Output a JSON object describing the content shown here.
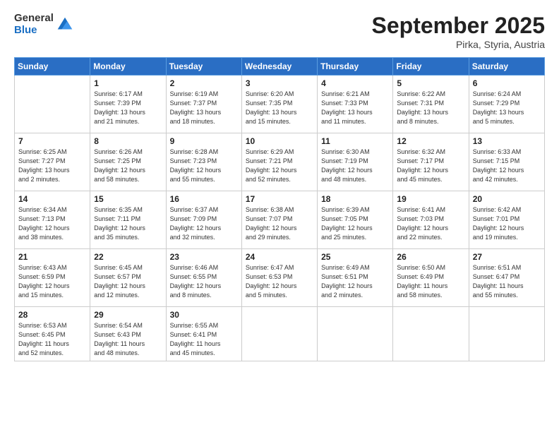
{
  "header": {
    "logo_general": "General",
    "logo_blue": "Blue",
    "month_title": "September 2025",
    "location": "Pirka, Styria, Austria"
  },
  "weekdays": [
    "Sunday",
    "Monday",
    "Tuesday",
    "Wednesday",
    "Thursday",
    "Friday",
    "Saturday"
  ],
  "weeks": [
    [
      {
        "day": "",
        "info": ""
      },
      {
        "day": "1",
        "info": "Sunrise: 6:17 AM\nSunset: 7:39 PM\nDaylight: 13 hours\nand 21 minutes."
      },
      {
        "day": "2",
        "info": "Sunrise: 6:19 AM\nSunset: 7:37 PM\nDaylight: 13 hours\nand 18 minutes."
      },
      {
        "day": "3",
        "info": "Sunrise: 6:20 AM\nSunset: 7:35 PM\nDaylight: 13 hours\nand 15 minutes."
      },
      {
        "day": "4",
        "info": "Sunrise: 6:21 AM\nSunset: 7:33 PM\nDaylight: 13 hours\nand 11 minutes."
      },
      {
        "day": "5",
        "info": "Sunrise: 6:22 AM\nSunset: 7:31 PM\nDaylight: 13 hours\nand 8 minutes."
      },
      {
        "day": "6",
        "info": "Sunrise: 6:24 AM\nSunset: 7:29 PM\nDaylight: 13 hours\nand 5 minutes."
      }
    ],
    [
      {
        "day": "7",
        "info": "Sunrise: 6:25 AM\nSunset: 7:27 PM\nDaylight: 13 hours\nand 2 minutes."
      },
      {
        "day": "8",
        "info": "Sunrise: 6:26 AM\nSunset: 7:25 PM\nDaylight: 12 hours\nand 58 minutes."
      },
      {
        "day": "9",
        "info": "Sunrise: 6:28 AM\nSunset: 7:23 PM\nDaylight: 12 hours\nand 55 minutes."
      },
      {
        "day": "10",
        "info": "Sunrise: 6:29 AM\nSunset: 7:21 PM\nDaylight: 12 hours\nand 52 minutes."
      },
      {
        "day": "11",
        "info": "Sunrise: 6:30 AM\nSunset: 7:19 PM\nDaylight: 12 hours\nand 48 minutes."
      },
      {
        "day": "12",
        "info": "Sunrise: 6:32 AM\nSunset: 7:17 PM\nDaylight: 12 hours\nand 45 minutes."
      },
      {
        "day": "13",
        "info": "Sunrise: 6:33 AM\nSunset: 7:15 PM\nDaylight: 12 hours\nand 42 minutes."
      }
    ],
    [
      {
        "day": "14",
        "info": "Sunrise: 6:34 AM\nSunset: 7:13 PM\nDaylight: 12 hours\nand 38 minutes."
      },
      {
        "day": "15",
        "info": "Sunrise: 6:35 AM\nSunset: 7:11 PM\nDaylight: 12 hours\nand 35 minutes."
      },
      {
        "day": "16",
        "info": "Sunrise: 6:37 AM\nSunset: 7:09 PM\nDaylight: 12 hours\nand 32 minutes."
      },
      {
        "day": "17",
        "info": "Sunrise: 6:38 AM\nSunset: 7:07 PM\nDaylight: 12 hours\nand 29 minutes."
      },
      {
        "day": "18",
        "info": "Sunrise: 6:39 AM\nSunset: 7:05 PM\nDaylight: 12 hours\nand 25 minutes."
      },
      {
        "day": "19",
        "info": "Sunrise: 6:41 AM\nSunset: 7:03 PM\nDaylight: 12 hours\nand 22 minutes."
      },
      {
        "day": "20",
        "info": "Sunrise: 6:42 AM\nSunset: 7:01 PM\nDaylight: 12 hours\nand 19 minutes."
      }
    ],
    [
      {
        "day": "21",
        "info": "Sunrise: 6:43 AM\nSunset: 6:59 PM\nDaylight: 12 hours\nand 15 minutes."
      },
      {
        "day": "22",
        "info": "Sunrise: 6:45 AM\nSunset: 6:57 PM\nDaylight: 12 hours\nand 12 minutes."
      },
      {
        "day": "23",
        "info": "Sunrise: 6:46 AM\nSunset: 6:55 PM\nDaylight: 12 hours\nand 8 minutes."
      },
      {
        "day": "24",
        "info": "Sunrise: 6:47 AM\nSunset: 6:53 PM\nDaylight: 12 hours\nand 5 minutes."
      },
      {
        "day": "25",
        "info": "Sunrise: 6:49 AM\nSunset: 6:51 PM\nDaylight: 12 hours\nand 2 minutes."
      },
      {
        "day": "26",
        "info": "Sunrise: 6:50 AM\nSunset: 6:49 PM\nDaylight: 11 hours\nand 58 minutes."
      },
      {
        "day": "27",
        "info": "Sunrise: 6:51 AM\nSunset: 6:47 PM\nDaylight: 11 hours\nand 55 minutes."
      }
    ],
    [
      {
        "day": "28",
        "info": "Sunrise: 6:53 AM\nSunset: 6:45 PM\nDaylight: 11 hours\nand 52 minutes."
      },
      {
        "day": "29",
        "info": "Sunrise: 6:54 AM\nSunset: 6:43 PM\nDaylight: 11 hours\nand 48 minutes."
      },
      {
        "day": "30",
        "info": "Sunrise: 6:55 AM\nSunset: 6:41 PM\nDaylight: 11 hours\nand 45 minutes."
      },
      {
        "day": "",
        "info": ""
      },
      {
        "day": "",
        "info": ""
      },
      {
        "day": "",
        "info": ""
      },
      {
        "day": "",
        "info": ""
      }
    ]
  ]
}
